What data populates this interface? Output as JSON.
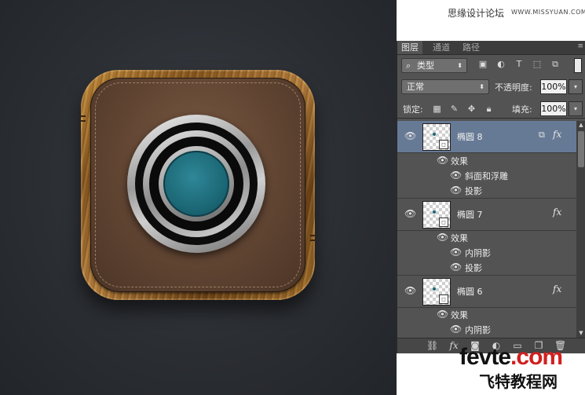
{
  "header": {
    "site_title": "思缘设计论坛",
    "site_url": "WWW.MISSYUAN.COM"
  },
  "panel": {
    "tabs": [
      "图层",
      "通道",
      "路径"
    ],
    "menu_icon": "≡",
    "filter_label": "类型",
    "blend_mode": "正常",
    "opacity_label": "不透明度:",
    "opacity_value": "100%",
    "lock_label": "锁定:",
    "fill_label": "填充:",
    "fill_value": "100%",
    "layers": [
      {
        "name": "椭圆 8",
        "selected": true,
        "effects_label": "效果",
        "effects": [
          "斜面和浮雕",
          "投影"
        ]
      },
      {
        "name": "椭圆 7",
        "selected": false,
        "effects_label": "效果",
        "effects": [
          "内阴影",
          "投影"
        ]
      },
      {
        "name": "椭圆 6",
        "selected": false,
        "effects_label": "效果",
        "effects": [
          "内阴影"
        ]
      }
    ],
    "fx_label": "fx"
  },
  "watermark": {
    "brand_part1": "fevte",
    "brand_part2": ".com",
    "brand_cn": "飞特教程网"
  },
  "colors": {
    "selected_layer": "#677a95",
    "panel_bg": "#535353",
    "lens_teal": "#1b6775"
  }
}
